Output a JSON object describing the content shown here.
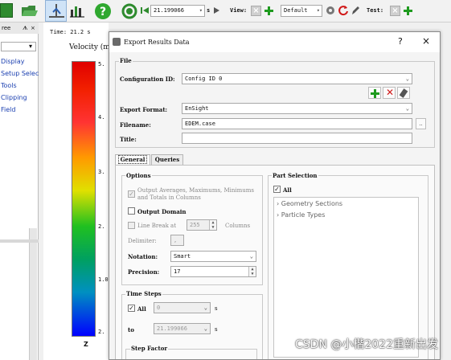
{
  "toolbar": {
    "time_value": "21.199066",
    "time_suffix": "s",
    "view_label": "View:",
    "view_value": "Default",
    "test_label": "Test:"
  },
  "left_panel": {
    "header": "ree",
    "pin": "ᗑ",
    "close": "×",
    "items": [
      "Display",
      "Setup Selec",
      "Tools",
      "Clipping",
      "Field"
    ]
  },
  "viewport": {
    "time_label": "Time: 21.2 s",
    "legend_title": "Velocity (m",
    "ticks": [
      "5.",
      "4.",
      "3.",
      "2.",
      "1.0",
      "2."
    ],
    "axis_label": "Z"
  },
  "dialog": {
    "title": "Export Results Data",
    "help": "?",
    "close": "×",
    "file_group": "File",
    "config_label": "Configuration ID:",
    "config_value": "Config ID 0",
    "format_label": "Export Format:",
    "format_value": "EnSight",
    "filename_label": "Filename:",
    "filename_value": "EDEM.case",
    "browse_label": "..",
    "title_label": "Title:",
    "title_value": "",
    "tabs": [
      "General",
      "Queries"
    ],
    "options_group": "Options",
    "output_averages_label": "Output Averages, Maximums, Minimums and Totals in Columns",
    "output_averages_checked": "✓",
    "output_domain_label": "Output Domain",
    "line_break_label": "Line Break at",
    "line_break_value": "255",
    "columns_label": "Columns",
    "delimiter_label": "Delimiter:",
    "delimiter_value": ",",
    "notation_label": "Notation:",
    "notation_value": "Smart",
    "precision_label": "Precision:",
    "precision_value": "17",
    "timesteps_group": "Time Steps",
    "all_label": "All",
    "all_checked": "✓",
    "from_value": "0",
    "to_label": "to",
    "to_value": "21.199066",
    "unit_s": "s",
    "step_factor_label": "Step Factor",
    "part_selection_group": "Part Selection",
    "part_all_label": "All",
    "part_all_checked": "✓",
    "part_tree": [
      "Geometry Sections",
      "Particle Types"
    ]
  },
  "watermark": "CSDN @小楷2022重新出发",
  "colors": {
    "accent_green": "#1e9a1e",
    "delete_red": "#d01818",
    "link_blue": "#1a3fb0"
  },
  "icons": [
    "folder-icon",
    "open-icon",
    "chart-icon",
    "help-icon",
    "play-icon",
    "first-frame-icon",
    "add-icon",
    "delete-icon",
    "reset-icon",
    "settings-icon",
    "edit-icon"
  ]
}
